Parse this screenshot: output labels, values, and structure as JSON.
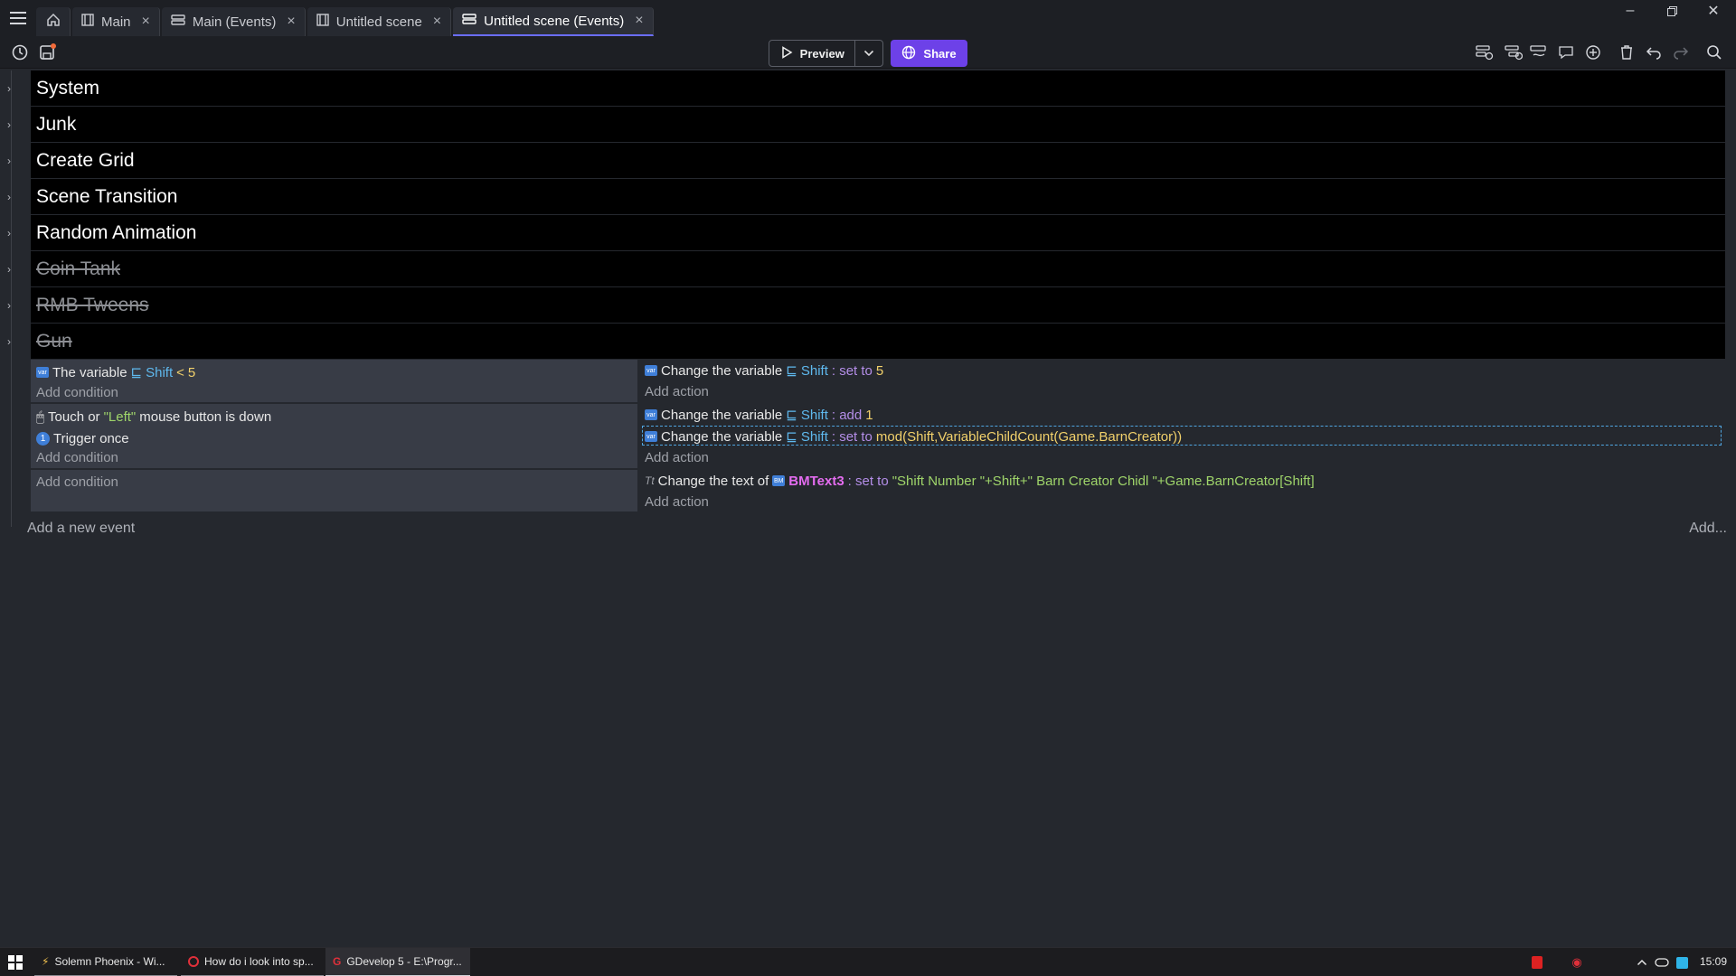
{
  "tabs": [
    {
      "label": "Main",
      "icon": "scene-icon"
    },
    {
      "label": "Main (Events)",
      "icon": "events-icon"
    },
    {
      "label": "Untitled scene",
      "icon": "scene-icon"
    },
    {
      "label": "Untitled scene (Events)",
      "icon": "events-icon",
      "active": true
    }
  ],
  "toolbar": {
    "preview_label": "Preview",
    "share_label": "Share",
    "accent_color": "#6d41e8"
  },
  "groups": [
    {
      "label": "System",
      "disabled": false
    },
    {
      "label": "Junk",
      "disabled": false
    },
    {
      "label": "Create Grid",
      "disabled": false
    },
    {
      "label": "Scene Transition",
      "disabled": false
    },
    {
      "label": "Random Animation",
      "disabled": false
    },
    {
      "label": "Coin Tank",
      "disabled": true
    },
    {
      "label": "RMB Tweens",
      "disabled": true
    },
    {
      "label": "Gun",
      "disabled": true
    }
  ],
  "events": [
    {
      "conditions": [
        {
          "text": "The variable",
          "var": "Shift",
          "op": "<",
          "value": "5"
        }
      ],
      "add_condition": "Add condition",
      "actions": [
        {
          "text": "Change the variable",
          "var": "Shift",
          "op": ": set to",
          "value": "5"
        }
      ],
      "add_action": "Add action"
    },
    {
      "conditions": [
        {
          "pre": "Touch or",
          "str": "\"Left\"",
          "post": "mouse button is down"
        },
        {
          "text": "Trigger once"
        }
      ],
      "add_condition": "Add condition",
      "actions": [
        {
          "text": "Change the variable",
          "var": "Shift",
          "op": ": add",
          "value": "1"
        },
        {
          "text": "Change the variable",
          "var": "Shift",
          "op": ": set to",
          "value": "mod(Shift,VariableChildCount(Game.BarnCreator))"
        }
      ],
      "add_action": "Add action"
    },
    {
      "conditions": [],
      "add_condition": "Add condition",
      "actions": [
        {
          "text": "Change the text of",
          "obj": "BMText3",
          "op": ": set to",
          "value": "\"Shift Number \"+Shift+\" Barn Creator Chidl \"+Game.BarnCreator[Shift]"
        }
      ],
      "add_action": "Add action"
    }
  ],
  "footer": {
    "add_event": "Add a new event",
    "add_more": "Add..."
  },
  "taskbar": {
    "items": [
      {
        "label": "Solemn Phoenix - Wi...",
        "icon": "spark-icon"
      },
      {
        "label": "How do i look into sp...",
        "icon": "opera-icon"
      },
      {
        "label": "GDevelop 5 - E:\\Progr...",
        "icon": "gdevelop-icon"
      }
    ],
    "clock": "15:09"
  }
}
